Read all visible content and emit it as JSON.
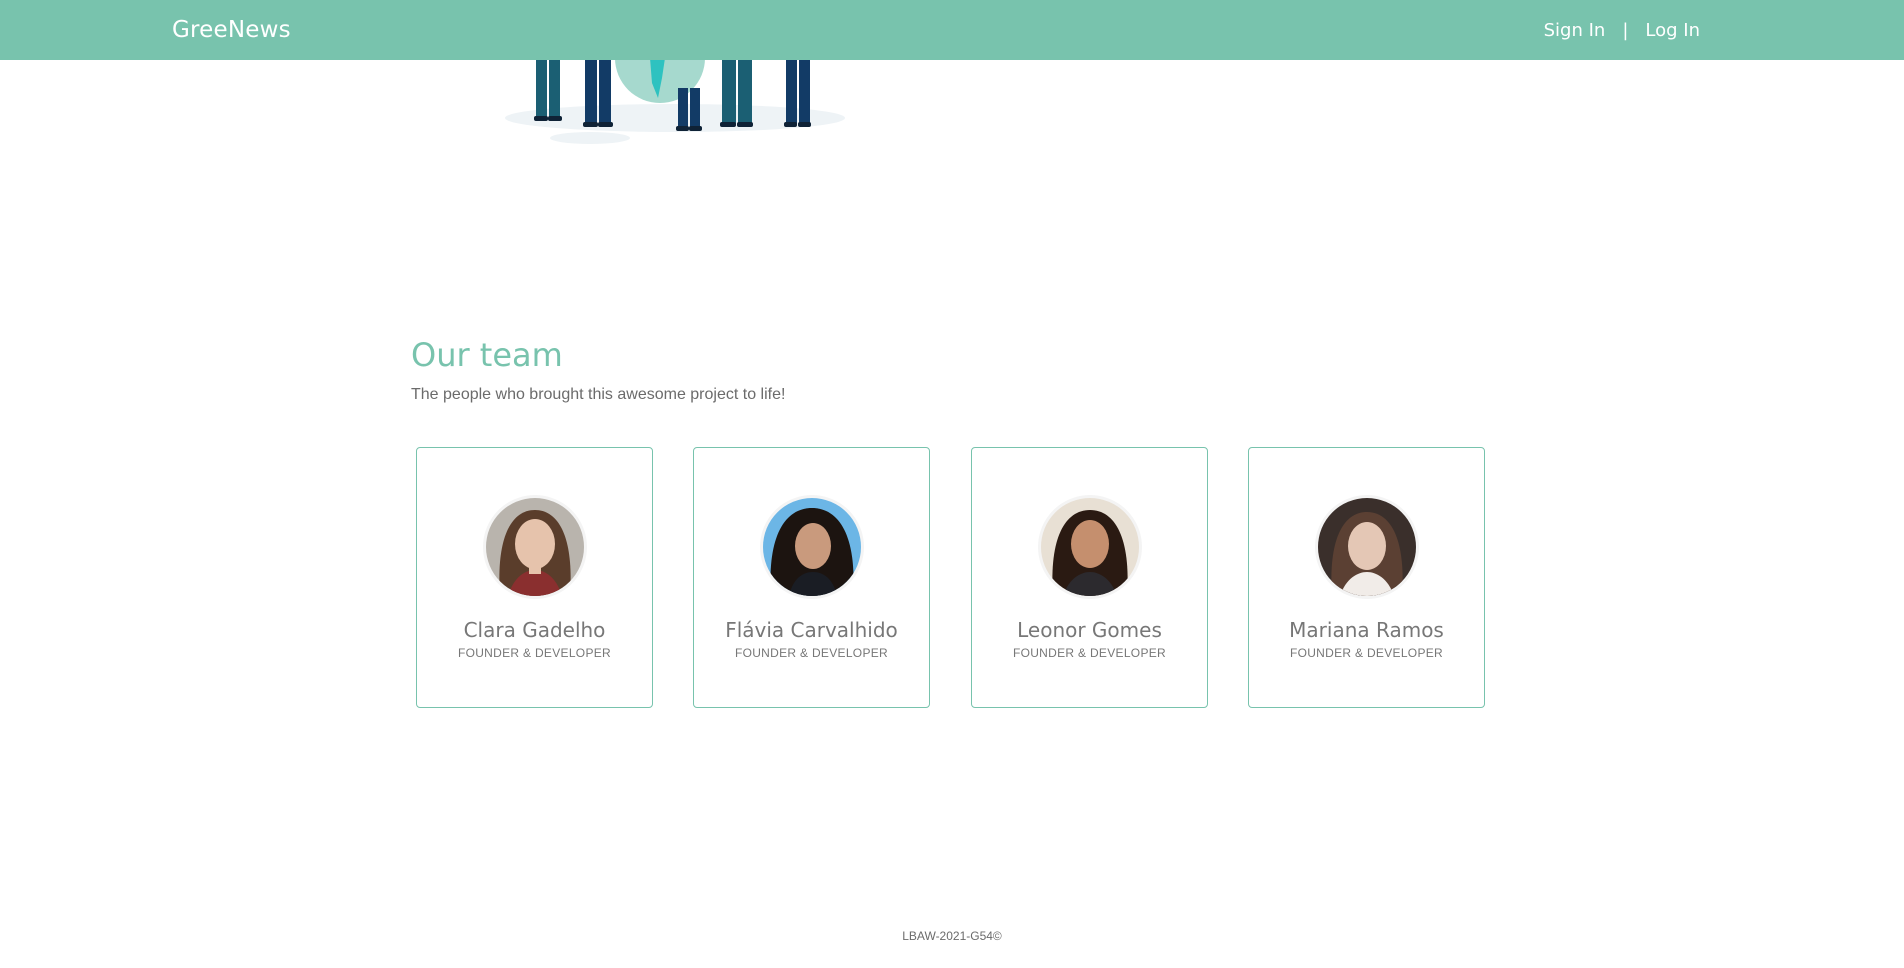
{
  "navbar": {
    "brand": "GreeNews",
    "sign_in": "Sign In",
    "separator": "|",
    "log_in": "Log In",
    "background_color": "#78c3ad"
  },
  "team": {
    "title": "Our team",
    "subtitle": "The people who brought this awesome project to life!",
    "members": [
      {
        "name": "Clara Gadelho",
        "role": "FOUNDER & DEVELOPER"
      },
      {
        "name": "Flávia Carvalhido",
        "role": "FOUNDER & DEVELOPER"
      },
      {
        "name": "Leonor Gomes",
        "role": "FOUNDER & DEVELOPER"
      },
      {
        "name": "Mariana Ramos",
        "role": "FOUNDER & DEVELOPER"
      }
    ],
    "accent_color": "#78c3ad"
  },
  "footer": {
    "text": "LBAW-2021-G54©"
  }
}
